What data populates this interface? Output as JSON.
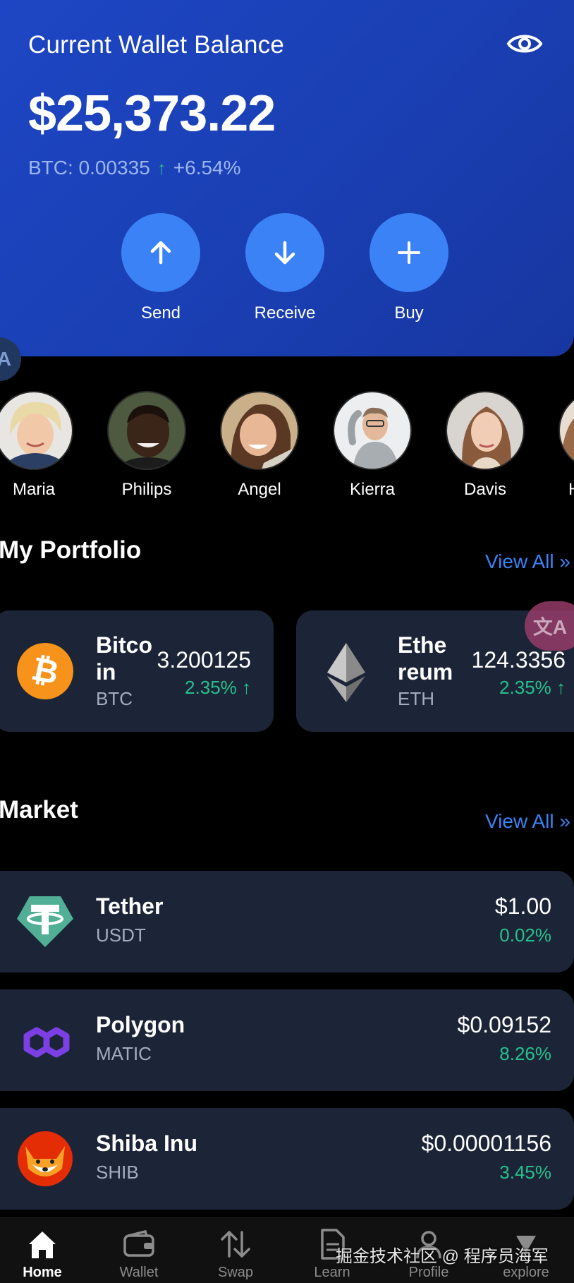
{
  "header": {
    "title": "Current Wallet Balance",
    "balance": "$25,373.22",
    "btc_label": "BTC: 0.00335",
    "btc_change": "+6.54%",
    "actions": [
      {
        "label": "Send",
        "icon": "arrow-up-icon"
      },
      {
        "label": "Receive",
        "icon": "arrow-down-icon"
      },
      {
        "label": "Buy",
        "icon": "plus-icon"
      }
    ]
  },
  "edge_bubble": "A",
  "contacts": [
    {
      "name": "Maria"
    },
    {
      "name": "Philips"
    },
    {
      "name": "Angel"
    },
    {
      "name": "Kierra"
    },
    {
      "name": "Davis"
    },
    {
      "name": "H"
    }
  ],
  "portfolio": {
    "title": "My Portfolio",
    "view_all": "View All »",
    "cards": [
      {
        "name_line1": "Bitco",
        "name_line2": "in",
        "symbol": "BTC",
        "amount": "3.200125",
        "change": "2.35% ↑",
        "icon": "bitcoin-icon"
      },
      {
        "name_line1": "Ethe",
        "name_line2": "reum",
        "symbol": "ETH",
        "amount": "124.3356",
        "change": "2.35% ↑",
        "icon": "ethereum-icon"
      }
    ]
  },
  "market": {
    "title": "Market",
    "view_all": "View All »",
    "rows": [
      {
        "name": "Tether",
        "symbol": "USDT",
        "price": "$1.00",
        "change": "0.02%",
        "icon": "tether-icon"
      },
      {
        "name": "Polygon",
        "symbol": "MATIC",
        "price": "$0.09152",
        "change": "8.26%",
        "icon": "polygon-icon"
      },
      {
        "name": "Shiba Inu",
        "symbol": "SHIB",
        "price": "$0.00001156",
        "change": "3.45%",
        "icon": "shiba-icon"
      }
    ]
  },
  "nav": {
    "items": [
      {
        "label": "Home",
        "icon": "home-icon"
      },
      {
        "label": "Wallet",
        "icon": "wallet-icon"
      },
      {
        "label": "Swap",
        "icon": "swap-icon"
      },
      {
        "label": "Learn",
        "icon": "document-icon"
      },
      {
        "label": "Profile",
        "icon": "user-icon"
      },
      {
        "label": "explore",
        "icon": "explore-icon"
      }
    ],
    "active": "Home"
  },
  "watermark": "掘金技术社区 @ 程序员海军",
  "colors": {
    "header_bg": "#1e46c4",
    "accent": "#3b82f6",
    "positive": "#25c08d",
    "card_bg": "#1c2537"
  }
}
